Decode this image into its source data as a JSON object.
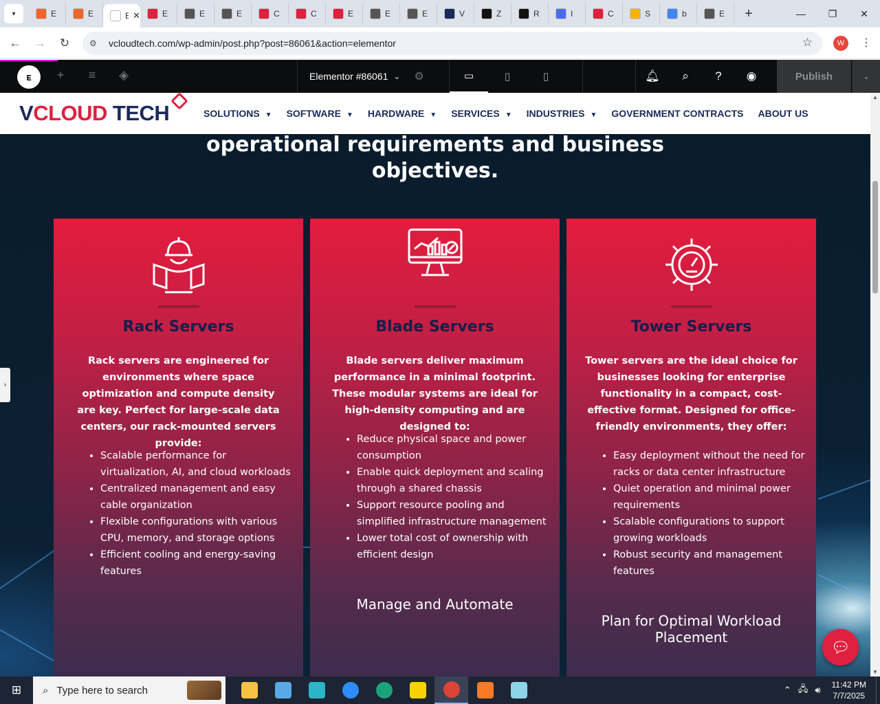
{
  "browser": {
    "tabs": [
      {
        "label": "E",
        "favicon_color": "#f0642e"
      },
      {
        "label": "E",
        "favicon_color": "#f0642e"
      },
      {
        "label": "E",
        "favicon_color": "#ffffff",
        "active": true
      },
      {
        "label": "E",
        "favicon_color": "#e0203f"
      },
      {
        "label": "E",
        "favicon_color": "#555555"
      },
      {
        "label": "E",
        "favicon_color": "#555555"
      },
      {
        "label": "C",
        "favicon_color": "#e0203f"
      },
      {
        "label": "C",
        "favicon_color": "#e0203f"
      },
      {
        "label": "E",
        "favicon_color": "#e0203f"
      },
      {
        "label": "E",
        "favicon_color": "#555555"
      },
      {
        "label": "E",
        "favicon_color": "#555555"
      },
      {
        "label": "V",
        "favicon_color": "#1a2a5a"
      },
      {
        "label": "Z",
        "favicon_color": "#111111"
      },
      {
        "label": "R",
        "favicon_color": "#111111"
      },
      {
        "label": "I",
        "favicon_color": "#4a6cf7"
      },
      {
        "label": "C",
        "favicon_color": "#e0203f"
      },
      {
        "label": "S",
        "favicon_color": "#f4b400"
      },
      {
        "label": "b",
        "favicon_color": "#4285f4"
      },
      {
        "label": "E",
        "favicon_color": "#555555"
      }
    ],
    "active_tab_close": "✕",
    "url": "vcloudtech.com/wp-admin/post.php?post=86061&action=elementor",
    "profile_initial": "W"
  },
  "elementor": {
    "document_title": "Elementor #86061",
    "publish_label": "Publish"
  },
  "site": {
    "logo_v": "V",
    "logo_cloud": "CLOUD",
    "logo_tech": "TECH",
    "menu": [
      {
        "label": "SOLUTIONS",
        "has_dropdown": true
      },
      {
        "label": "SOFTWARE",
        "has_dropdown": true
      },
      {
        "label": "HARDWARE",
        "has_dropdown": true
      },
      {
        "label": "SERVICES",
        "has_dropdown": true
      },
      {
        "label": "INDUSTRIES",
        "has_dropdown": true
      },
      {
        "label": "GOVERNMENT CONTRACTS",
        "has_dropdown": false
      },
      {
        "label": "ABOUT US",
        "has_dropdown": false
      }
    ],
    "heading": "operational requirements and business objectives.",
    "cards": [
      {
        "icon": "engineer-icon",
        "title": "Rack Servers",
        "intro": "Rack servers are engineered for environments where space optimization and compute density are key. Perfect for large-scale data centers, our rack-mounted servers provide:",
        "bullets": [
          "Scalable performance for virtualization, AI, and cloud workloads",
          "Centralized management and easy cable organization",
          "Flexible configurations with various CPU, memory, and storage options",
          "Efficient cooling and energy-saving features"
        ],
        "subheading": ""
      },
      {
        "icon": "monitor-analytics-icon",
        "title": "Blade Servers",
        "intro": "Blade servers deliver maximum performance in a minimal footprint. These modular systems are ideal for high-density computing and are designed to:",
        "bullets": [
          "Reduce physical space and power consumption",
          "Enable quick deployment and scaling through a shared chassis",
          "Support resource pooling and simplified infrastructure management",
          "Lower total cost of ownership with efficient design"
        ],
        "subheading": "Manage and Automate"
      },
      {
        "icon": "gear-gauge-icon",
        "title": "Tower Servers",
        "intro": "Tower servers are the ideal choice for businesses looking for enterprise functionality in a compact, cost-effective format. Designed for office-friendly environments, they offer:",
        "bullets": [
          "Easy deployment without the need for racks or data center infrastructure",
          "Quiet operation and minimal power requirements",
          "Scalable configurations to support growing workloads",
          "Robust security and management features"
        ],
        "subheading": "Plan for Optimal Workload Placement"
      }
    ]
  },
  "taskbar": {
    "search_placeholder": "Type here to search",
    "time": "11:42 PM",
    "date": "7/7/2025",
    "apps": [
      {
        "name": "file-explorer",
        "color": "#f5c342"
      },
      {
        "name": "paint",
        "color": "#5aa9e6"
      },
      {
        "name": "app-diamond",
        "color": "#2bb5c9"
      },
      {
        "name": "zoom",
        "color": "#2d8cff"
      },
      {
        "name": "edge",
        "color": "#1aa37a"
      },
      {
        "name": "sticky-notes",
        "color": "#f7d200"
      },
      {
        "name": "chrome",
        "color": "#db4437",
        "active": true
      },
      {
        "name": "xampp",
        "color": "#fb7a24"
      },
      {
        "name": "app-notes",
        "color": "#8fd3e8"
      }
    ]
  }
}
